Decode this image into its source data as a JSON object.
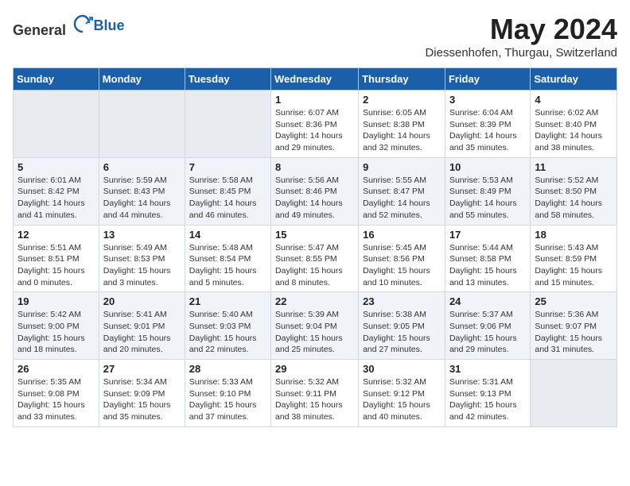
{
  "logo": {
    "text_general": "General",
    "text_blue": "Blue"
  },
  "title": "May 2024",
  "location": "Diessenhofen, Thurgau, Switzerland",
  "days_of_week": [
    "Sunday",
    "Monday",
    "Tuesday",
    "Wednesday",
    "Thursday",
    "Friday",
    "Saturday"
  ],
  "weeks": [
    [
      {
        "num": "",
        "info": ""
      },
      {
        "num": "",
        "info": ""
      },
      {
        "num": "",
        "info": ""
      },
      {
        "num": "1",
        "info": "Sunrise: 6:07 AM\nSunset: 8:36 PM\nDaylight: 14 hours\nand 29 minutes."
      },
      {
        "num": "2",
        "info": "Sunrise: 6:05 AM\nSunset: 8:38 PM\nDaylight: 14 hours\nand 32 minutes."
      },
      {
        "num": "3",
        "info": "Sunrise: 6:04 AM\nSunset: 8:39 PM\nDaylight: 14 hours\nand 35 minutes."
      },
      {
        "num": "4",
        "info": "Sunrise: 6:02 AM\nSunset: 8:40 PM\nDaylight: 14 hours\nand 38 minutes."
      }
    ],
    [
      {
        "num": "5",
        "info": "Sunrise: 6:01 AM\nSunset: 8:42 PM\nDaylight: 14 hours\nand 41 minutes."
      },
      {
        "num": "6",
        "info": "Sunrise: 5:59 AM\nSunset: 8:43 PM\nDaylight: 14 hours\nand 44 minutes."
      },
      {
        "num": "7",
        "info": "Sunrise: 5:58 AM\nSunset: 8:45 PM\nDaylight: 14 hours\nand 46 minutes."
      },
      {
        "num": "8",
        "info": "Sunrise: 5:56 AM\nSunset: 8:46 PM\nDaylight: 14 hours\nand 49 minutes."
      },
      {
        "num": "9",
        "info": "Sunrise: 5:55 AM\nSunset: 8:47 PM\nDaylight: 14 hours\nand 52 minutes."
      },
      {
        "num": "10",
        "info": "Sunrise: 5:53 AM\nSunset: 8:49 PM\nDaylight: 14 hours\nand 55 minutes."
      },
      {
        "num": "11",
        "info": "Sunrise: 5:52 AM\nSunset: 8:50 PM\nDaylight: 14 hours\nand 58 minutes."
      }
    ],
    [
      {
        "num": "12",
        "info": "Sunrise: 5:51 AM\nSunset: 8:51 PM\nDaylight: 15 hours\nand 0 minutes."
      },
      {
        "num": "13",
        "info": "Sunrise: 5:49 AM\nSunset: 8:53 PM\nDaylight: 15 hours\nand 3 minutes."
      },
      {
        "num": "14",
        "info": "Sunrise: 5:48 AM\nSunset: 8:54 PM\nDaylight: 15 hours\nand 5 minutes."
      },
      {
        "num": "15",
        "info": "Sunrise: 5:47 AM\nSunset: 8:55 PM\nDaylight: 15 hours\nand 8 minutes."
      },
      {
        "num": "16",
        "info": "Sunrise: 5:45 AM\nSunset: 8:56 PM\nDaylight: 15 hours\nand 10 minutes."
      },
      {
        "num": "17",
        "info": "Sunrise: 5:44 AM\nSunset: 8:58 PM\nDaylight: 15 hours\nand 13 minutes."
      },
      {
        "num": "18",
        "info": "Sunrise: 5:43 AM\nSunset: 8:59 PM\nDaylight: 15 hours\nand 15 minutes."
      }
    ],
    [
      {
        "num": "19",
        "info": "Sunrise: 5:42 AM\nSunset: 9:00 PM\nDaylight: 15 hours\nand 18 minutes."
      },
      {
        "num": "20",
        "info": "Sunrise: 5:41 AM\nSunset: 9:01 PM\nDaylight: 15 hours\nand 20 minutes."
      },
      {
        "num": "21",
        "info": "Sunrise: 5:40 AM\nSunset: 9:03 PM\nDaylight: 15 hours\nand 22 minutes."
      },
      {
        "num": "22",
        "info": "Sunrise: 5:39 AM\nSunset: 9:04 PM\nDaylight: 15 hours\nand 25 minutes."
      },
      {
        "num": "23",
        "info": "Sunrise: 5:38 AM\nSunset: 9:05 PM\nDaylight: 15 hours\nand 27 minutes."
      },
      {
        "num": "24",
        "info": "Sunrise: 5:37 AM\nSunset: 9:06 PM\nDaylight: 15 hours\nand 29 minutes."
      },
      {
        "num": "25",
        "info": "Sunrise: 5:36 AM\nSunset: 9:07 PM\nDaylight: 15 hours\nand 31 minutes."
      }
    ],
    [
      {
        "num": "26",
        "info": "Sunrise: 5:35 AM\nSunset: 9:08 PM\nDaylight: 15 hours\nand 33 minutes."
      },
      {
        "num": "27",
        "info": "Sunrise: 5:34 AM\nSunset: 9:09 PM\nDaylight: 15 hours\nand 35 minutes."
      },
      {
        "num": "28",
        "info": "Sunrise: 5:33 AM\nSunset: 9:10 PM\nDaylight: 15 hours\nand 37 minutes."
      },
      {
        "num": "29",
        "info": "Sunrise: 5:32 AM\nSunset: 9:11 PM\nDaylight: 15 hours\nand 38 minutes."
      },
      {
        "num": "30",
        "info": "Sunrise: 5:32 AM\nSunset: 9:12 PM\nDaylight: 15 hours\nand 40 minutes."
      },
      {
        "num": "31",
        "info": "Sunrise: 5:31 AM\nSunset: 9:13 PM\nDaylight: 15 hours\nand 42 minutes."
      },
      {
        "num": "",
        "info": ""
      }
    ]
  ]
}
